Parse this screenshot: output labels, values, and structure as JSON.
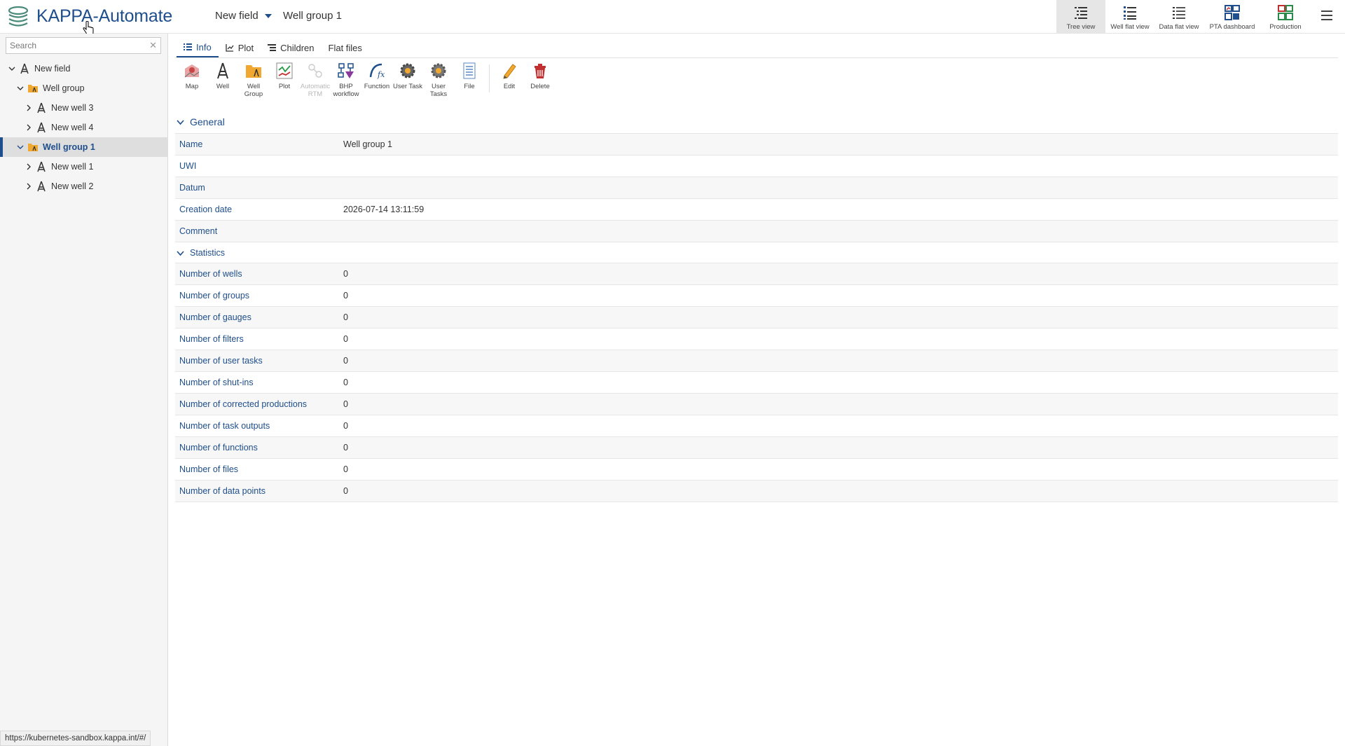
{
  "app": {
    "title": "KAPPA-Automate"
  },
  "breadcrumb": {
    "field": "New field",
    "group": "Well group 1"
  },
  "views": [
    {
      "label": "Tree view",
      "icon": "tree-view-icon"
    },
    {
      "label": "Well flat view",
      "icon": "well-flat-view-icon"
    },
    {
      "label": "Data flat view",
      "icon": "data-flat-view-icon"
    },
    {
      "label": "PTA dashboard",
      "icon": "pta-dashboard-icon"
    },
    {
      "label": "Production",
      "icon": "production-icon"
    }
  ],
  "sidebar": {
    "search_placeholder": "Search",
    "tree": [
      {
        "label": "New field",
        "level": 0
      },
      {
        "label": "Well group",
        "level": 1
      },
      {
        "label": "New well 3",
        "level": 2
      },
      {
        "label": "New well 4",
        "level": 2
      },
      {
        "label": "Well group 1",
        "level": 1,
        "selected": true
      },
      {
        "label": "New well 1",
        "level": 2
      },
      {
        "label": "New well 2",
        "level": 2
      }
    ]
  },
  "status_url": "https://kubernetes-sandbox.kappa.int/#/",
  "tabs": [
    {
      "label": "Info",
      "active": true
    },
    {
      "label": "Plot"
    },
    {
      "label": "Children"
    },
    {
      "label": "Flat files"
    }
  ],
  "toolbar": [
    {
      "label": "Map",
      "icon": "map-icon"
    },
    {
      "label": "Well",
      "icon": "well-icon"
    },
    {
      "label": "Well Group",
      "icon": "well-group-icon"
    },
    {
      "label": "Plot",
      "icon": "plot-icon"
    },
    {
      "label": "Automatic RTM",
      "icon": "automatic-rtm-icon",
      "disabled": true
    },
    {
      "label": "BHP workflow",
      "icon": "bhp-workflow-icon"
    },
    {
      "label": "Function",
      "icon": "function-icon"
    },
    {
      "label": "User Task",
      "icon": "user-task-icon"
    },
    {
      "label": "User Tasks",
      "icon": "user-tasks-icon"
    },
    {
      "label": "File",
      "icon": "file-icon"
    },
    {
      "label": "Edit",
      "icon": "edit-pencil-icon"
    },
    {
      "label": "Delete",
      "icon": "delete-trash-icon"
    }
  ],
  "general": {
    "title": "General",
    "rows": [
      {
        "key": "Name",
        "value": "Well group 1"
      },
      {
        "key": "UWI",
        "value": ""
      },
      {
        "key": "Datum",
        "value": ""
      },
      {
        "key": "Creation date",
        "value": "2026-07-14 13:11:59"
      },
      {
        "key": "Comment",
        "value": ""
      }
    ]
  },
  "statistics": {
    "title": "Statistics",
    "rows": [
      {
        "key": "Number of wells",
        "value": "0"
      },
      {
        "key": "Number of groups",
        "value": "0"
      },
      {
        "key": "Number of gauges",
        "value": "0"
      },
      {
        "key": "Number of filters",
        "value": "0"
      },
      {
        "key": "Number of user tasks",
        "value": "0"
      },
      {
        "key": "Number of shut-ins",
        "value": "0"
      },
      {
        "key": "Number of corrected productions",
        "value": "0"
      },
      {
        "key": "Number of task outputs",
        "value": "0"
      },
      {
        "key": "Number of functions",
        "value": "0"
      },
      {
        "key": "Number of files",
        "value": "0"
      },
      {
        "key": "Number of data points",
        "value": "0"
      }
    ]
  },
  "colors": {
    "accent": "#1e4e8c",
    "logo": "#4a8a7a",
    "folder": "#f0a830"
  }
}
